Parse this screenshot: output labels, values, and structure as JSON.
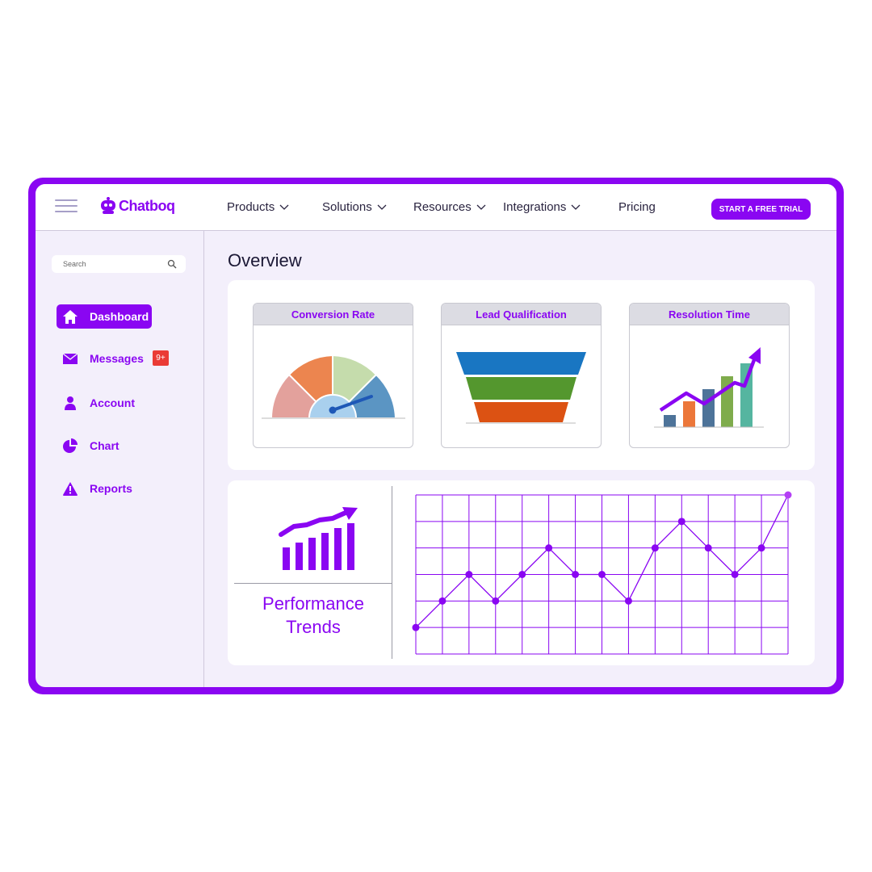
{
  "app": {
    "name": "Chatboq"
  },
  "nav": {
    "items": [
      {
        "label": "Products",
        "has_dropdown": true
      },
      {
        "label": "Solutions",
        "has_dropdown": true
      },
      {
        "label": "Resources",
        "has_dropdown": true
      },
      {
        "label": "Integrations",
        "has_dropdown": true
      },
      {
        "label": "Pricing",
        "has_dropdown": false
      }
    ],
    "cta_label": "START A FREE TRIAL"
  },
  "sidebar": {
    "search_placeholder": "Search",
    "items": [
      {
        "label": "Dashboard",
        "icon": "home-icon",
        "active": true
      },
      {
        "label": "Messages",
        "icon": "mail-icon",
        "badge": "9+"
      },
      {
        "label": "Account",
        "icon": "user-icon"
      },
      {
        "label": "Chart",
        "icon": "pie-chart-icon"
      },
      {
        "label": "Reports",
        "icon": "warning-icon"
      }
    ]
  },
  "main": {
    "title": "Overview",
    "cards": [
      {
        "title": "Conversion Rate",
        "visual": "gauge"
      },
      {
        "title": "Lead Qualification",
        "visual": "funnel"
      },
      {
        "title": "Resolution Time",
        "visual": "bar-trend"
      }
    ],
    "performance": {
      "line1": "Performance",
      "line2": "Trends"
    }
  },
  "colors": {
    "accent": "#8a06f2",
    "background": "#f3effb",
    "badge": "#ea3b35",
    "gauge": [
      "#e3a19c",
      "#ec854f",
      "#c5dcac",
      "#5b95c3"
    ],
    "funnel": [
      "#1976c2",
      "#54972e",
      "#dc5213"
    ],
    "bars": [
      "#4d7399",
      "#ec773a",
      "#4d7399",
      "#7fac4c",
      "#55b5a0"
    ]
  },
  "chart_data": {
    "type": "line",
    "title": "",
    "xlabel": "",
    "ylabel": "",
    "grid": true,
    "x": [
      0,
      1,
      2,
      3,
      4,
      5,
      6,
      7,
      8,
      9,
      10,
      11,
      12,
      13,
      14
    ],
    "y": [
      1,
      2,
      3,
      2,
      3,
      4,
      3,
      3,
      2,
      4,
      5,
      4,
      3,
      4,
      6
    ],
    "ylim": [
      0,
      6
    ]
  }
}
